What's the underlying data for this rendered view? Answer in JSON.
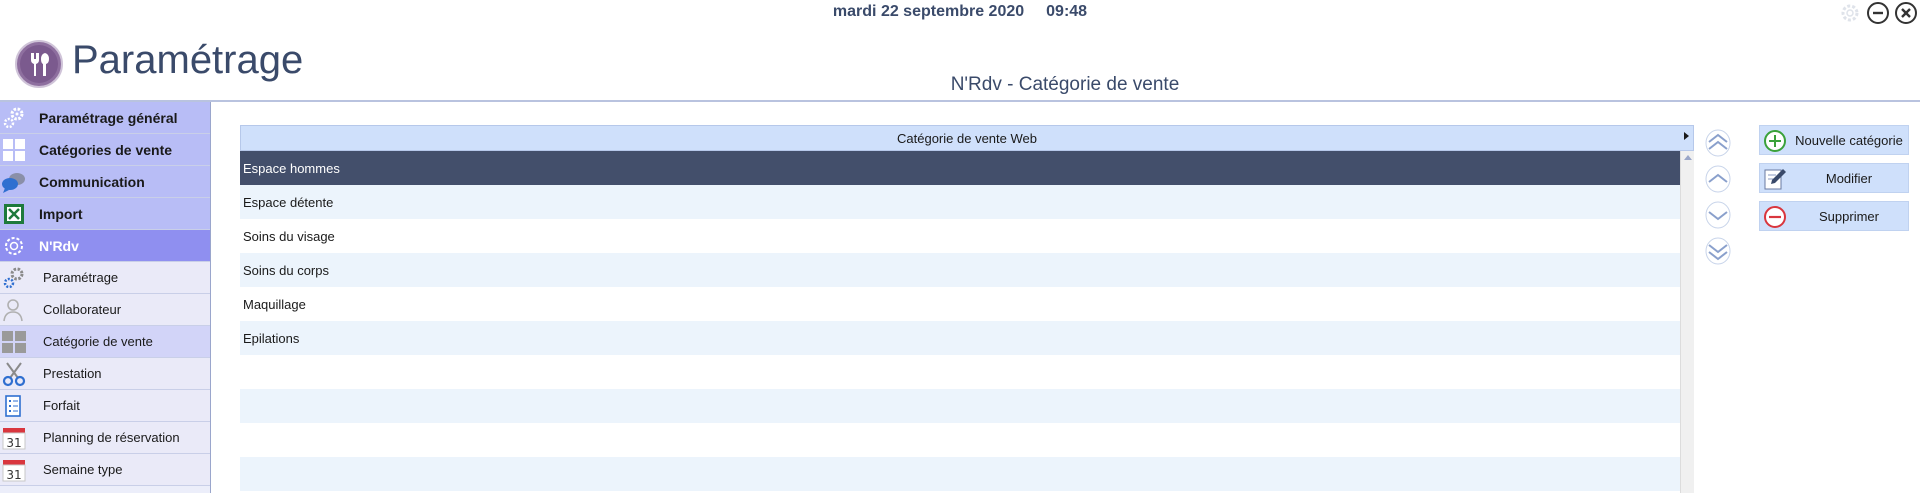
{
  "header": {
    "date": "mardi 22 septembre 2020",
    "time": "09:48",
    "app_title": "Paramétrage",
    "page_title": "N'Rdv - Catégorie de vente"
  },
  "sidebar": {
    "items": [
      {
        "label": "Paramétrage général",
        "icon": "gears-icon",
        "level": "main"
      },
      {
        "label": "Catégories de vente",
        "icon": "grid-icon",
        "level": "main"
      },
      {
        "label": "Communication",
        "icon": "chat-bubbles-icon",
        "level": "main"
      },
      {
        "label": "Import",
        "icon": "excel-icon",
        "level": "main"
      },
      {
        "label": "N'Rdv",
        "icon": "gear-outline-icon",
        "level": "main",
        "state": "active"
      },
      {
        "label": "Paramétrage",
        "icon": "gears-icon",
        "level": "sub"
      },
      {
        "label": "Collaborateur",
        "icon": "person-icon",
        "level": "sub"
      },
      {
        "label": "Catégorie de vente",
        "icon": "grid-icon",
        "level": "sub",
        "state": "selected"
      },
      {
        "label": "Prestation",
        "icon": "scissors-icon",
        "level": "sub"
      },
      {
        "label": "Forfait",
        "icon": "checklist-icon",
        "level": "sub"
      },
      {
        "label": "Planning de réservation",
        "icon": "calendar-icon",
        "level": "sub"
      },
      {
        "label": "Semaine type",
        "icon": "calendar-icon",
        "level": "sub"
      }
    ]
  },
  "grid": {
    "column_header": "Catégorie de vente Web",
    "rows": [
      "Espace hommes",
      "Espace détente",
      "Soins du visage",
      "Soins du corps",
      "Maquillage",
      "Epilations",
      "",
      "",
      "",
      ""
    ],
    "selected_row": 0
  },
  "move_buttons": [
    "move-top-icon",
    "move-up-icon",
    "move-down-icon",
    "move-bottom-icon"
  ],
  "actions": {
    "new_label": "Nouvelle catégorie",
    "edit_label": "Modifier",
    "delete_label": "Supprimer"
  },
  "colors": {
    "accent": "#8f8ff0",
    "selected_row": "#434f6b",
    "title": "#3a4a6a",
    "header_bg": "#cfe0fb",
    "add_green": "#3aa13a",
    "delete_red": "#d9363e"
  }
}
